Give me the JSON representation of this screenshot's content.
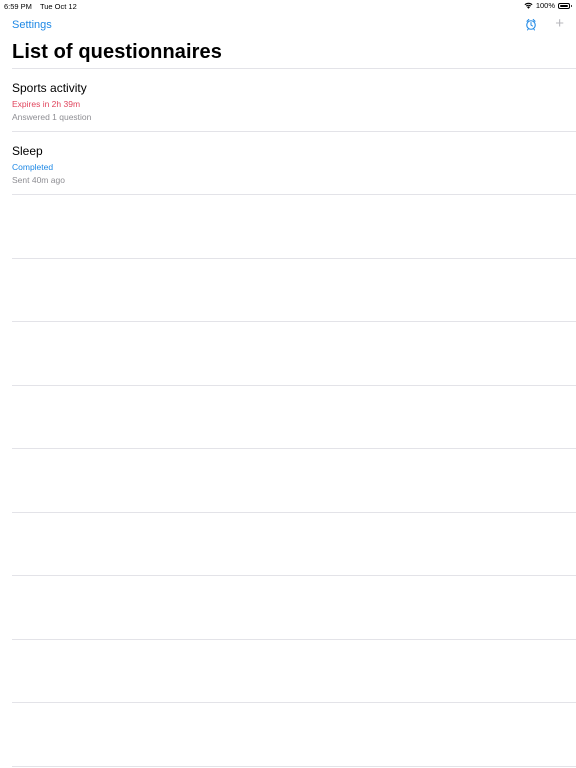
{
  "status_bar": {
    "time": "6:59 PM",
    "date": "Tue Oct 12",
    "battery": "100%",
    "battery_level": 1.0
  },
  "nav": {
    "settings_label": "Settings",
    "alarm_icon": "alarm-clock-icon",
    "add_icon": "plus-icon",
    "add_label": "+"
  },
  "page": {
    "title": "List of questionnaires"
  },
  "colors": {
    "accent": "#1e88e5",
    "expires": "#e0445c",
    "completed": "#1e88e5",
    "secondary": "#8e8e93",
    "add_disabled": "#b8b8bd"
  },
  "questionnaires": [
    {
      "title": "Sports activity",
      "status": "Expires in 2h 39m",
      "status_type": "expires",
      "subtitle": "Answered 1 question"
    },
    {
      "title": "Sleep",
      "status": "Completed",
      "status_type": "completed",
      "subtitle": "Sent 40m ago"
    }
  ]
}
